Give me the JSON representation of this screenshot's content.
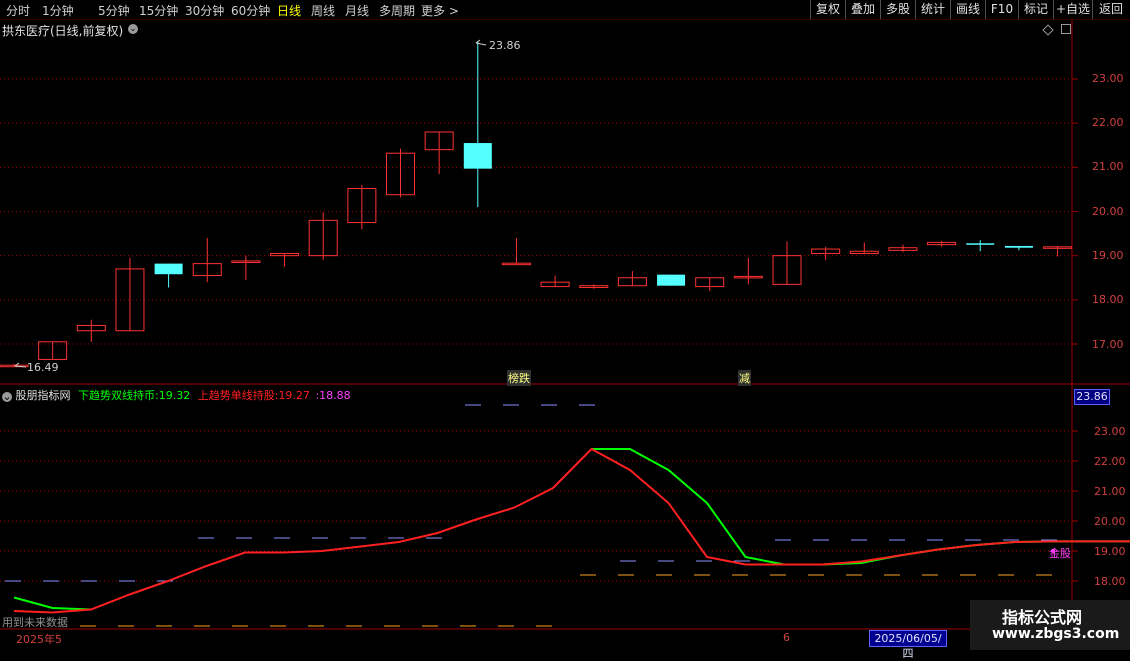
{
  "toolbar": {
    "periods": [
      "分时",
      "1分钟",
      "5分钟",
      "15分钟",
      "30分钟",
      "60分钟",
      "日线",
      "周线",
      "月线",
      "多周期",
      "更多 >"
    ],
    "active_period": "日线",
    "buttons": [
      "复权",
      "叠加",
      "多股",
      "统计",
      "画线",
      "F10",
      "标记",
      "+自选",
      "返回"
    ]
  },
  "main": {
    "title": "拱东医疗(日线,前复权)",
    "price_axis": [
      "23.00",
      "22.00",
      "21.00",
      "20.00",
      "19.00",
      "18.00",
      "17.00"
    ],
    "high_label": "23.86",
    "low_label": "16.49",
    "annotations": [
      "榜跌",
      "减"
    ],
    "colors": {
      "up": "#ff3232",
      "down": "#54ffff",
      "axis": "#a00000"
    },
    "candles": [
      {
        "o": 16.52,
        "c": 16.52,
        "h": 16.55,
        "l": 16.49
      },
      {
        "o": 16.65,
        "c": 17.05,
        "h": 17.05,
        "l": 16.65
      },
      {
        "o": 17.3,
        "c": 17.42,
        "h": 17.55,
        "l": 17.05
      },
      {
        "o": 17.3,
        "c": 18.7,
        "h": 18.95,
        "l": 17.3
      },
      {
        "o": 18.82,
        "c": 18.58,
        "h": 18.82,
        "l": 18.28
      },
      {
        "o": 18.55,
        "c": 18.82,
        "h": 19.4,
        "l": 18.4
      },
      {
        "o": 18.88,
        "c": 18.88,
        "h": 19.0,
        "l": 18.45
      },
      {
        "o": 19.0,
        "c": 19.05,
        "h": 19.05,
        "l": 18.75
      },
      {
        "o": 19.0,
        "c": 19.8,
        "h": 19.98,
        "l": 18.9
      },
      {
        "o": 19.75,
        "c": 20.52,
        "h": 20.6,
        "l": 19.6
      },
      {
        "o": 20.38,
        "c": 21.32,
        "h": 21.42,
        "l": 20.32
      },
      {
        "o": 21.4,
        "c": 21.8,
        "h": 21.8,
        "l": 20.85
      },
      {
        "o": 21.55,
        "c": 20.97,
        "h": 23.86,
        "l": 20.1
      },
      {
        "o": 18.83,
        "c": 18.83,
        "h": 19.4,
        "l": 18.83
      },
      {
        "o": 18.3,
        "c": 18.4,
        "h": 18.55,
        "l": 18.3
      },
      {
        "o": 18.28,
        "c": 18.32,
        "h": 18.35,
        "l": 18.25
      },
      {
        "o": 18.32,
        "c": 18.5,
        "h": 18.65,
        "l": 18.32
      },
      {
        "o": 18.57,
        "c": 18.32,
        "h": 18.57,
        "l": 18.32
      },
      {
        "o": 18.3,
        "c": 18.5,
        "h": 18.5,
        "l": 18.2
      },
      {
        "o": 18.53,
        "c": 18.53,
        "h": 18.95,
        "l": 18.35
      },
      {
        "o": 18.35,
        "c": 19.0,
        "h": 19.32,
        "l": 18.35
      },
      {
        "o": 19.05,
        "c": 19.15,
        "h": 19.2,
        "l": 18.9
      },
      {
        "o": 19.05,
        "c": 19.1,
        "h": 19.3,
        "l": 19.05
      },
      {
        "o": 19.12,
        "c": 19.18,
        "h": 19.25,
        "l": 19.08
      },
      {
        "o": 19.25,
        "c": 19.3,
        "h": 19.33,
        "l": 19.2
      },
      {
        "o": 19.28,
        "c": 19.25,
        "h": 19.35,
        "l": 19.1
      },
      {
        "o": 19.22,
        "c": 19.18,
        "h": 19.22,
        "l": 19.12
      },
      {
        "o": 19.18,
        "c": 19.2,
        "h": 19.22,
        "l": 18.98
      }
    ]
  },
  "indicator": {
    "name": "股朋指标网",
    "label_green": "下趋势双线持币:",
    "value_green": "19.32",
    "label_red": "上趋势单线持股:",
    "value_red": "19.27",
    "value_magenta": ":18.88",
    "current_price_box": "23.86",
    "price_axis": [
      "23.00",
      "22.00",
      "21.00",
      "20.00",
      "19.00",
      "18.00"
    ],
    "side_label": "金股",
    "bottom_left_note": "用到未来数据",
    "colors": {
      "green": "#00ff00",
      "red": "#ff2020",
      "magenta": "#ff40ff",
      "lavender": "#9090ff",
      "orange": "#ffa020"
    },
    "red_line": [
      17.0,
      16.95,
      17.05,
      17.55,
      18.0,
      18.5,
      18.95,
      18.95,
      19.0,
      19.15,
      19.3,
      19.6,
      20.05,
      20.45,
      21.1,
      22.4,
      21.7,
      20.6,
      18.8,
      18.55,
      18.55,
      18.55,
      18.65,
      18.85,
      19.05,
      19.2,
      19.3,
      19.32,
      19.32,
      19.32,
      19.32,
      19.27
    ],
    "green_line": [
      17.45,
      17.1,
      17.05,
      null,
      null,
      null,
      null,
      null,
      null,
      null,
      null,
      null,
      null,
      null,
      null,
      22.4,
      22.4,
      21.7,
      20.6,
      18.8,
      18.55,
      18.55,
      18.6,
      18.85,
      19.05,
      19.2,
      19.3,
      19.32,
      19.32,
      19.32,
      19.32,
      19.32
    ]
  },
  "date_axis": {
    "left_label": "2025年5",
    "mid_label": "6",
    "cursor_date": "2025/06/05/四"
  },
  "watermark": {
    "line1": "指标公式网",
    "line2": "www.zbgs3.com"
  }
}
